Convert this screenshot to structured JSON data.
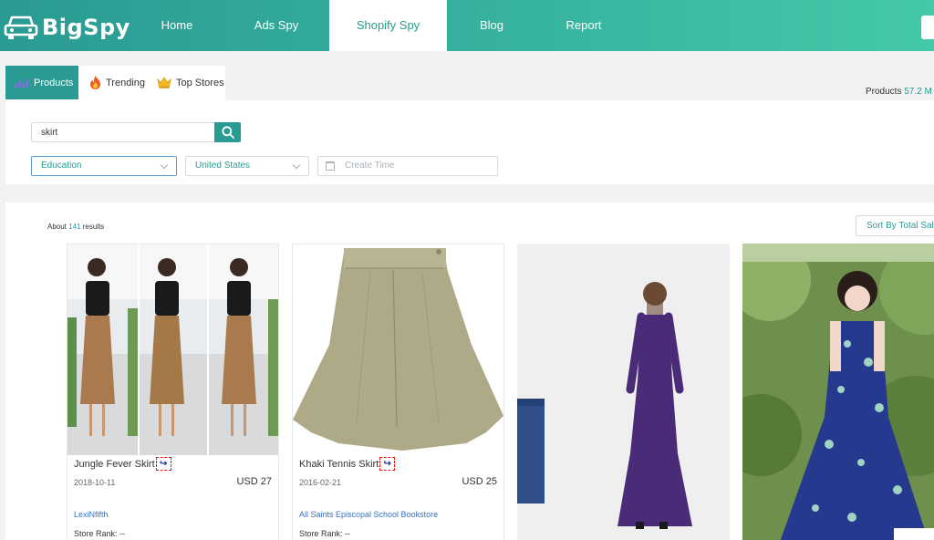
{
  "header": {
    "brand": "BigSpy",
    "nav": [
      {
        "label": "Home"
      },
      {
        "label": "Ads Spy"
      },
      {
        "label": "Shopify Spy",
        "active": true
      },
      {
        "label": "Blog"
      },
      {
        "label": "Report"
      }
    ]
  },
  "tabs": [
    {
      "label": "Products",
      "icon": "bar-chart-icon",
      "active": true
    },
    {
      "label": "Trending",
      "icon": "fire-icon"
    },
    {
      "label": "Top Stores",
      "icon": "crown-icon"
    }
  ],
  "summary": {
    "label": "Products",
    "count": "57.2 M"
  },
  "filters": {
    "search_value": "skirt",
    "category": "Education",
    "country": "United States",
    "date_placeholder": "Create Time"
  },
  "results": {
    "prefix": "About",
    "count": "141",
    "suffix": "results",
    "sort_label": "Sort By Total Sales"
  },
  "products": [
    {
      "title": "Jungle Fever Skirt",
      "date": "2018-10-11",
      "price": "USD 27",
      "store": "LexiNfifth",
      "rank": "Store Rank: --",
      "share_glyph": "↪"
    },
    {
      "title": "Khaki Tennis Skirt",
      "date": "2016-02-21",
      "price": "USD 25",
      "store": "All Saints Episcopal School Bookstore",
      "rank": "Store Rank: --",
      "share_glyph": "↪"
    }
  ],
  "colors": {
    "accent": "#2a9b92",
    "link": "#3a73c2"
  }
}
